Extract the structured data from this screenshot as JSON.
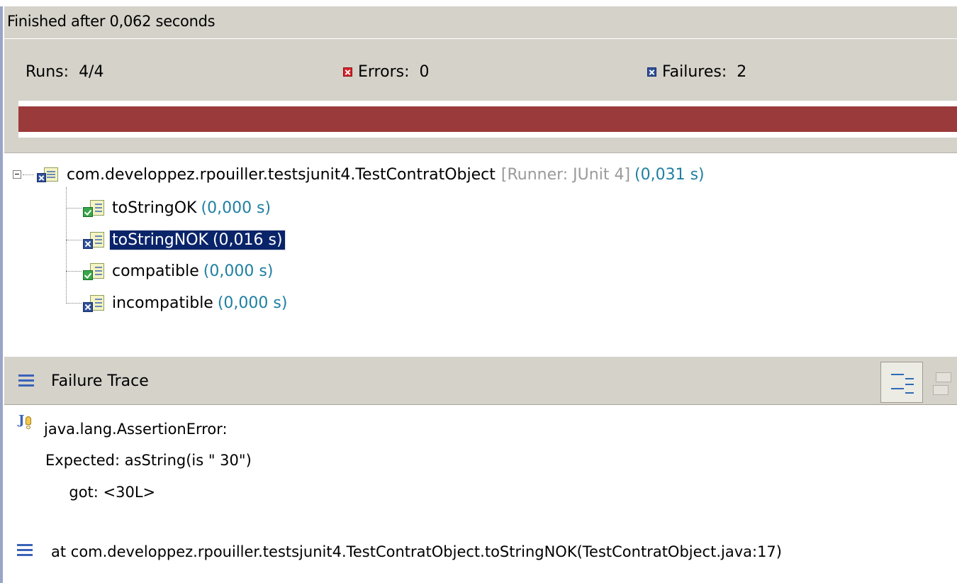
{
  "status": {
    "finished_text": "Finished after 0,062 seconds",
    "runs_label": "Runs:",
    "runs_value": "4/4",
    "errors_label": "Errors:",
    "errors_value": "0",
    "failures_label": "Failures:",
    "failures_value": "2",
    "progress_fraction": 1.0,
    "progress_color": "#9b3a3a",
    "error_icon": "error-x-icon",
    "failure_icon": "failure-x-icon"
  },
  "tree": {
    "root": {
      "name": "com.developpez.rpouiller.testsjunit4.TestContratObject",
      "runner": "[Runner: JUnit 4]",
      "time": "(0,031 s)",
      "icon": "test-suite-failed-icon"
    },
    "items": [
      {
        "name": "toStringOK",
        "time": "(0,000 s)",
        "status": "ok"
      },
      {
        "name": "toStringNOK",
        "time": "(0,016 s)",
        "status": "failed",
        "selected": true
      },
      {
        "name": "compatible",
        "time": "(0,000 s)",
        "status": "ok"
      },
      {
        "name": "incompatible",
        "time": "(0,000 s)",
        "status": "failed"
      }
    ]
  },
  "trace": {
    "title": "Failure Trace",
    "lines": [
      "java.lang.AssertionError:",
      "Expected: asString(is \" 30\")",
      "     got: <30L>",
      "at com.developpez.rpouiller.testsjunit4.TestContratObject.toStringNOK(TestContratObject.java:17)"
    ],
    "colors": {
      "accent": "#3a63b8",
      "time": "#1f7fa2",
      "runner": "#9a9a9a",
      "selection": "#0a246a"
    }
  }
}
